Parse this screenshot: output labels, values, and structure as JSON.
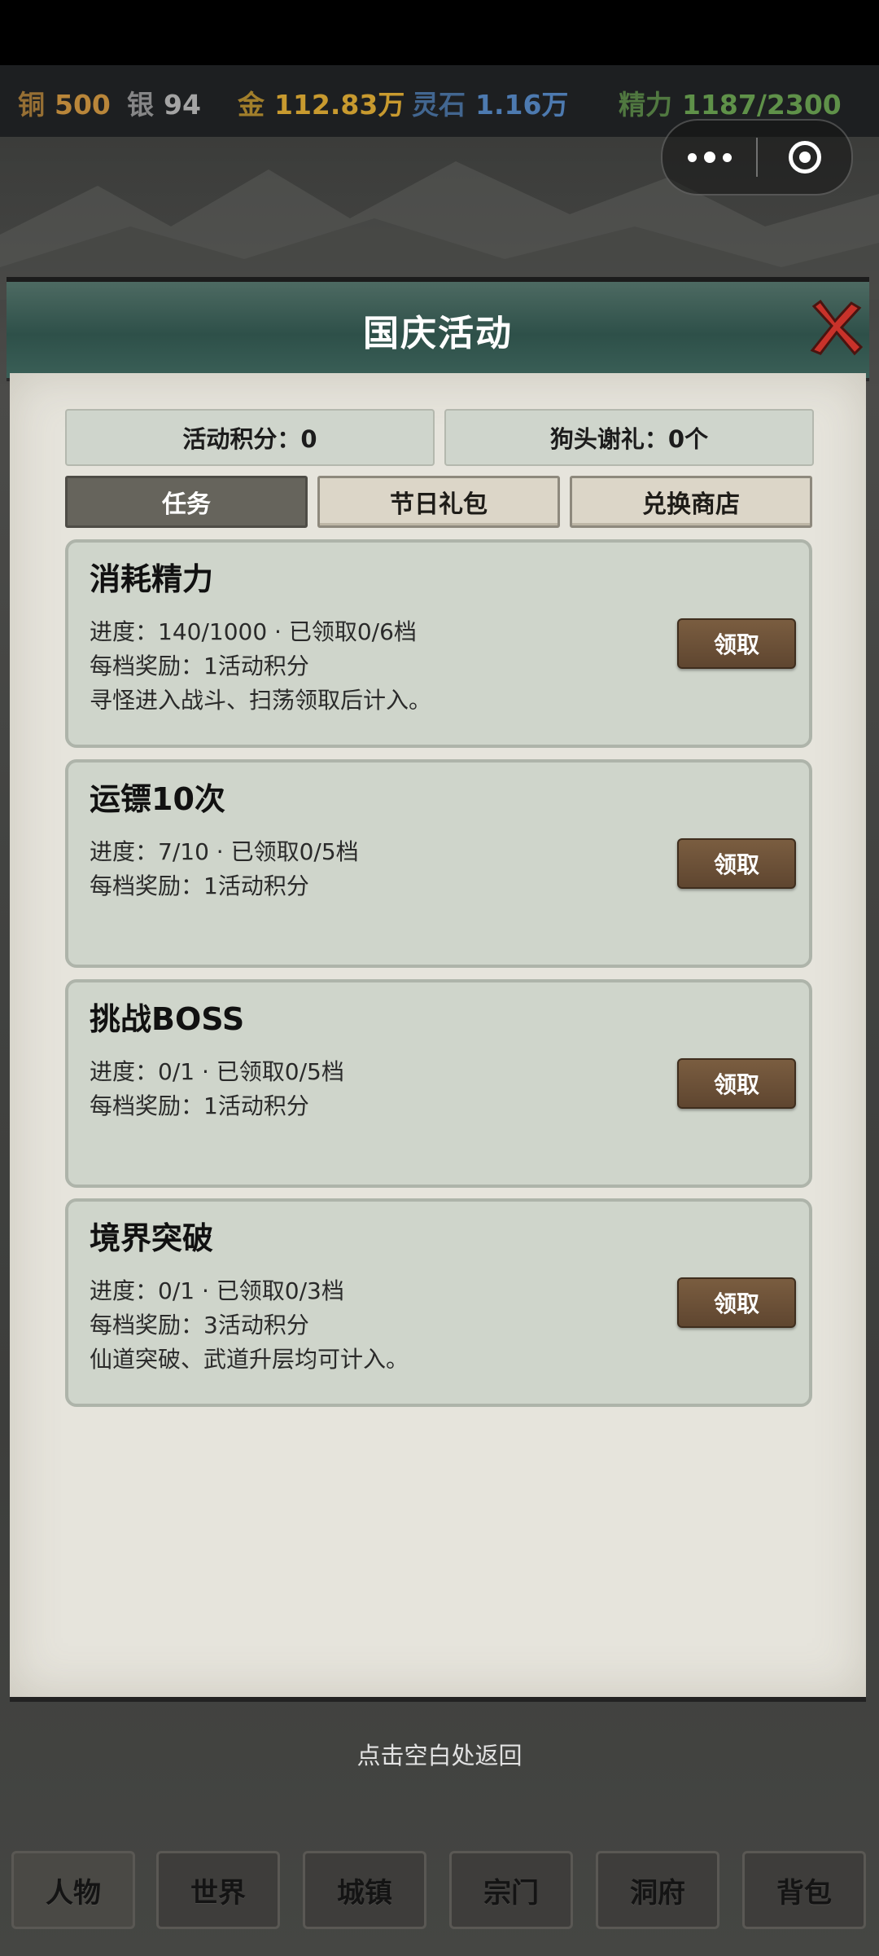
{
  "currency": {
    "copper": {
      "label": "铜",
      "value": "500",
      "color": "#b9863a"
    },
    "silver": {
      "label": "银",
      "value": "94",
      "color": "#a4a4a4"
    },
    "gold": {
      "label": "金",
      "value": "112.83万",
      "color": "#c89a2f"
    },
    "spirit_stone": {
      "label": "灵石",
      "value": "1.16万",
      "color": "#4d7ab0"
    },
    "energy": {
      "label": "精力",
      "value": "1187/2300",
      "color": "#5f9149"
    }
  },
  "modal": {
    "title": "国庆活动",
    "stats": {
      "points": "活动积分：0",
      "gift": "狗头谢礼：0个"
    },
    "tabs": [
      {
        "label": "任务",
        "active": true
      },
      {
        "label": "节日礼包",
        "active": false
      },
      {
        "label": "兑换商店",
        "active": false
      }
    ],
    "tasks": [
      {
        "title": "消耗精力",
        "progress": "进度：140/1000 · 已领取0/6档",
        "reward": "每档奖励：1活动积分",
        "note": "寻怪进入战斗、扫荡领取后计入。",
        "button": "领取"
      },
      {
        "title": "运镖10次",
        "progress": "进度：7/10 · 已领取0/5档",
        "reward": "每档奖励：1活动积分",
        "note": "",
        "button": "领取"
      },
      {
        "title": "挑战BOSS",
        "progress": "进度：0/1 · 已领取0/5档",
        "reward": "每档奖励：1活动积分",
        "note": "",
        "button": "领取"
      },
      {
        "title": "境界突破",
        "progress": "进度：0/1 · 已领取0/3档",
        "reward": "每档奖励：3活动积分",
        "note": "仙道突破、武道升层均可计入。",
        "button": "领取"
      }
    ]
  },
  "return_hint": "点击空白处返回",
  "bottom_nav": [
    "人物",
    "世界",
    "城镇",
    "宗门",
    "洞府",
    "背包"
  ],
  "icons": {
    "close": "close-x-icon",
    "more": "more-dots-icon",
    "miniapp": "target-circle-icon"
  }
}
